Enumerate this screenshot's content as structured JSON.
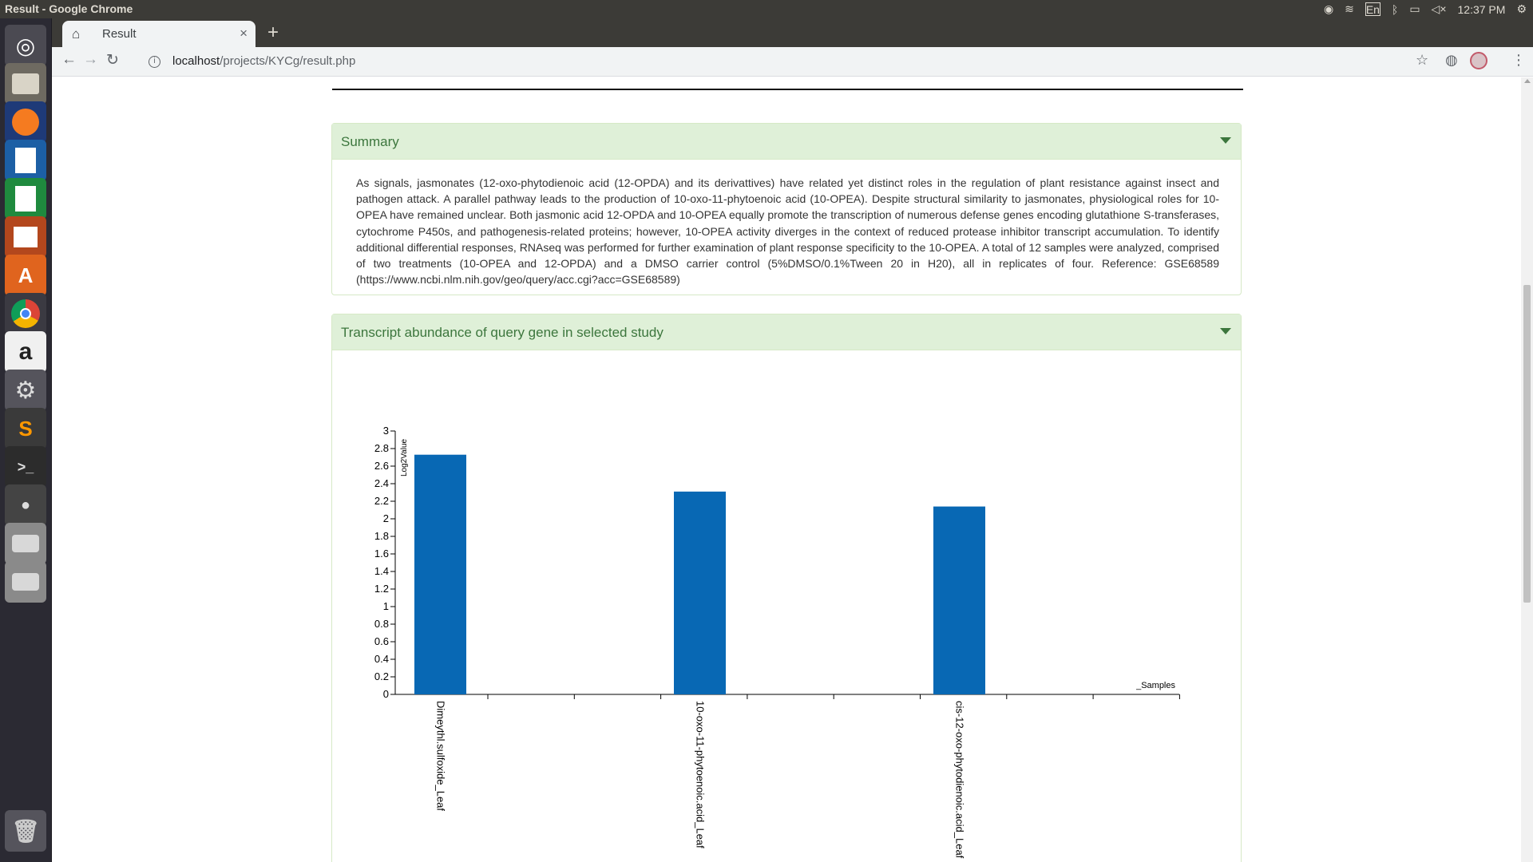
{
  "os": {
    "window_title": "Result - Google Chrome",
    "keyboard_layout": "En",
    "clock": "12:37 PM"
  },
  "launcher": {
    "items": [
      "dash-icon",
      "files-icon",
      "firefox-icon",
      "writer-icon",
      "calc-icon",
      "impress-icon",
      "software-center-icon",
      "chrome-icon",
      "amazon-icon",
      "system-settings-icon",
      "sublime-text-icon",
      "terminal-icon",
      "screen-recorder-icon",
      "drive-icon",
      "drive-icon",
      "trash-icon"
    ],
    "labels": {
      "sublime": "S",
      "amazon": "a"
    }
  },
  "browser": {
    "tab_title": "Result",
    "url_host": "localhost",
    "url_path": "/projects/KYCg/result.php"
  },
  "summary": {
    "title": "Summary",
    "text": "As signals, jasmonates (12-oxo-phytodienoic acid (12-OPDA) and its derivattives) have related yet distinct roles in the regulation of plant resistance against insect and pathogen attack. A parallel pathway leads to the production of 10-oxo-11-phytoenoic acid (10-OPEA). Despite structural similarity to jasmonates, physiological roles for 10-OPEA have remained unclear. Both jasmonic acid 12-OPDA and 10-OPEA equally promote the transcription of numerous defense genes encoding glutathione S-transferases, cytochrome P450s, and pathogenesis-related proteins; however, 10-OPEA activity diverges in the context of reduced protease inhibitor transcript accumulation. To identify additional differential responses, RNAseq was performed for further examination of plant response specificity to the 10-OPEA. A total of 12 samples were analyzed, comprised of two treatments (10-OPEA and 12-OPDA) and a DMSO carrier control (5%DMSO/0.1%Tween 20 in H20), all in replicates of four. Reference: GSE68589 (https://www.ncbi.nlm.nih.gov/geo/query/acc.cgi?acc=GSE68589)"
  },
  "abundance_panel": {
    "title": "Transcript abundance of query gene in selected study"
  },
  "chart_data": {
    "type": "bar",
    "categories": [
      "Dimeythl.sulfoxide_Leaf",
      "10-oxo-11-phytoenoic.acid_Leaf",
      "cis-12-oxo-phytodienoic.acid_Leaf"
    ],
    "values": [
      2.73,
      2.31,
      2.14
    ],
    "xlabel": "_Samples",
    "ylabel": "Log2Value",
    "ylim": [
      0,
      3
    ],
    "yticks": [
      "0",
      "0.2",
      "0.4",
      "0.6",
      "0.8",
      "1",
      "1.2",
      "1.4",
      "1.6",
      "1.8",
      "2",
      "2.2",
      "2.4",
      "2.6",
      "2.8",
      "3"
    ],
    "bar_color": "#0868b4",
    "grid": false,
    "legend": "none"
  }
}
